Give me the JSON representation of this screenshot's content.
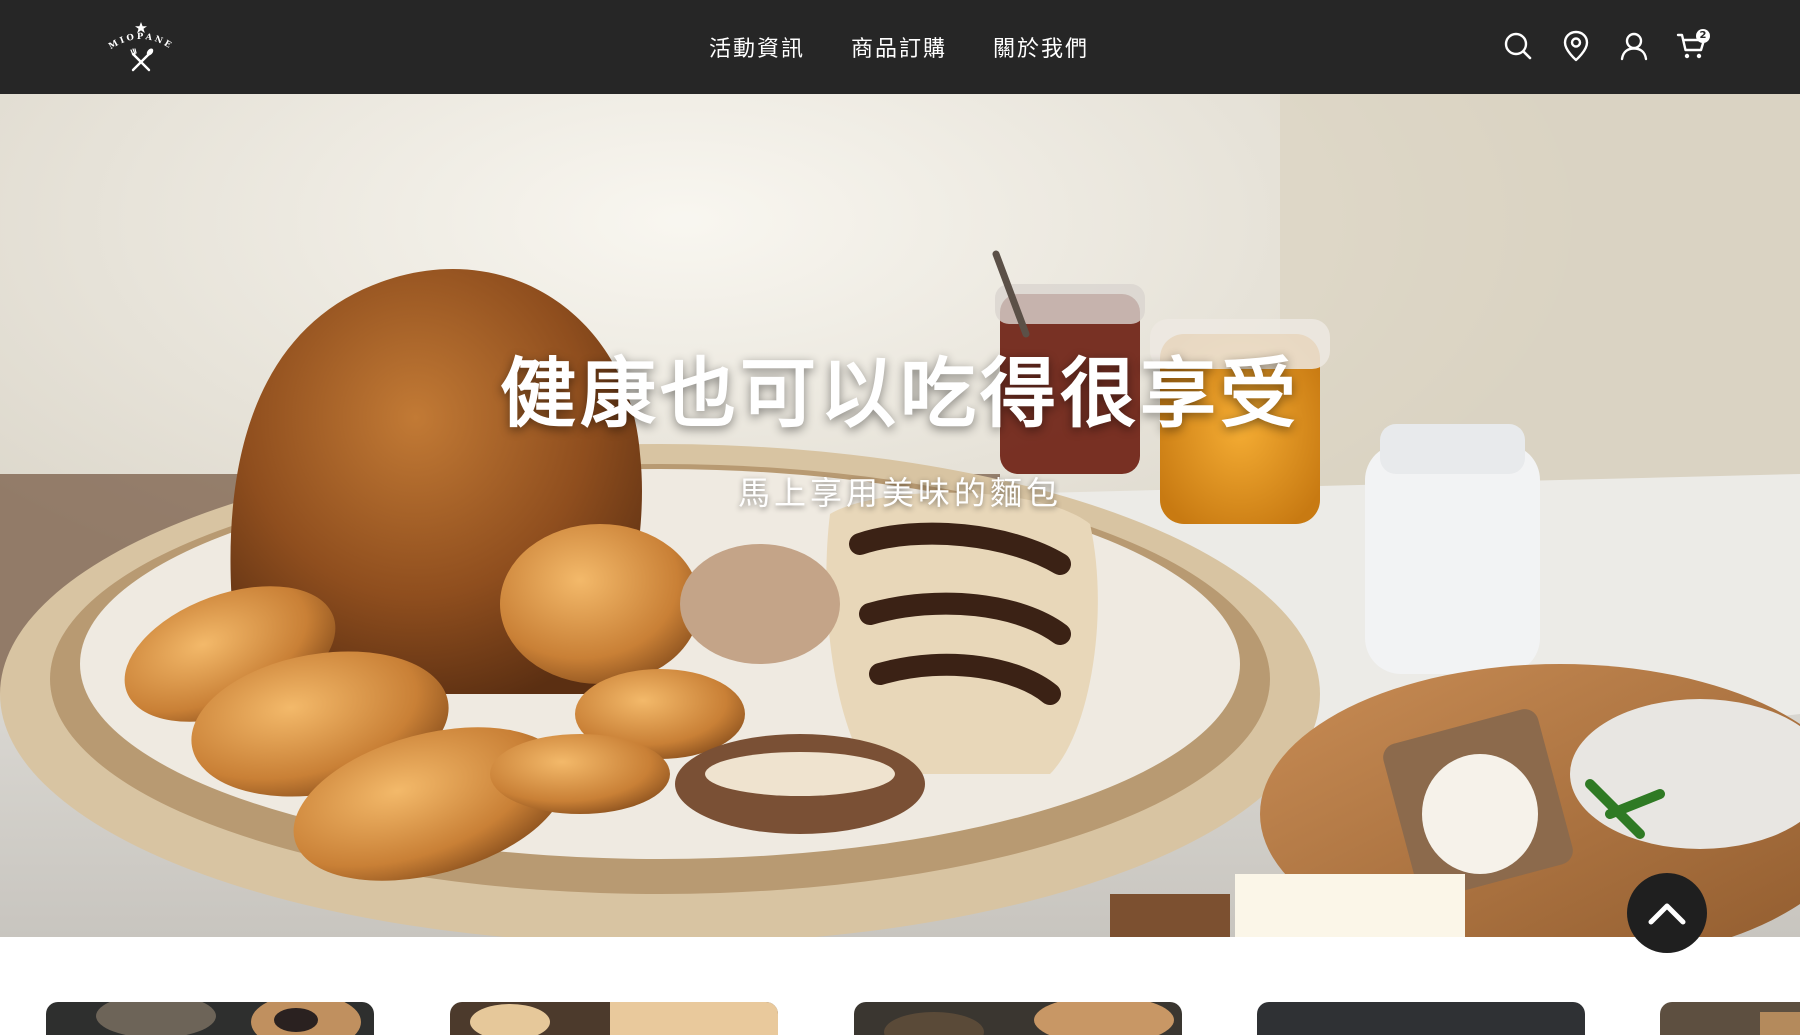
{
  "header": {
    "logo_text": "MIOPANE",
    "nav": [
      {
        "label": "活動資訊"
      },
      {
        "label": "商品訂購"
      },
      {
        "label": "關於我們"
      }
    ],
    "icons": [
      "search-icon",
      "location-pin-icon",
      "user-icon",
      "cart-icon"
    ],
    "cart_count": "2"
  },
  "hero": {
    "title": "健康也可以吃得很享受",
    "subtitle": "馬上享用美味的麵包"
  },
  "scroll_top": {
    "icon": "chevron-up-icon"
  },
  "products": [
    {
      "name": "product-card-1"
    },
    {
      "name": "product-card-2"
    },
    {
      "name": "product-card-3"
    },
    {
      "name": "product-card-4"
    },
    {
      "name": "product-card-5"
    }
  ],
  "colors": {
    "header_bg": "#262626",
    "text_light": "#ffffff",
    "scroll_button_bg": "#1f1f1f"
  }
}
